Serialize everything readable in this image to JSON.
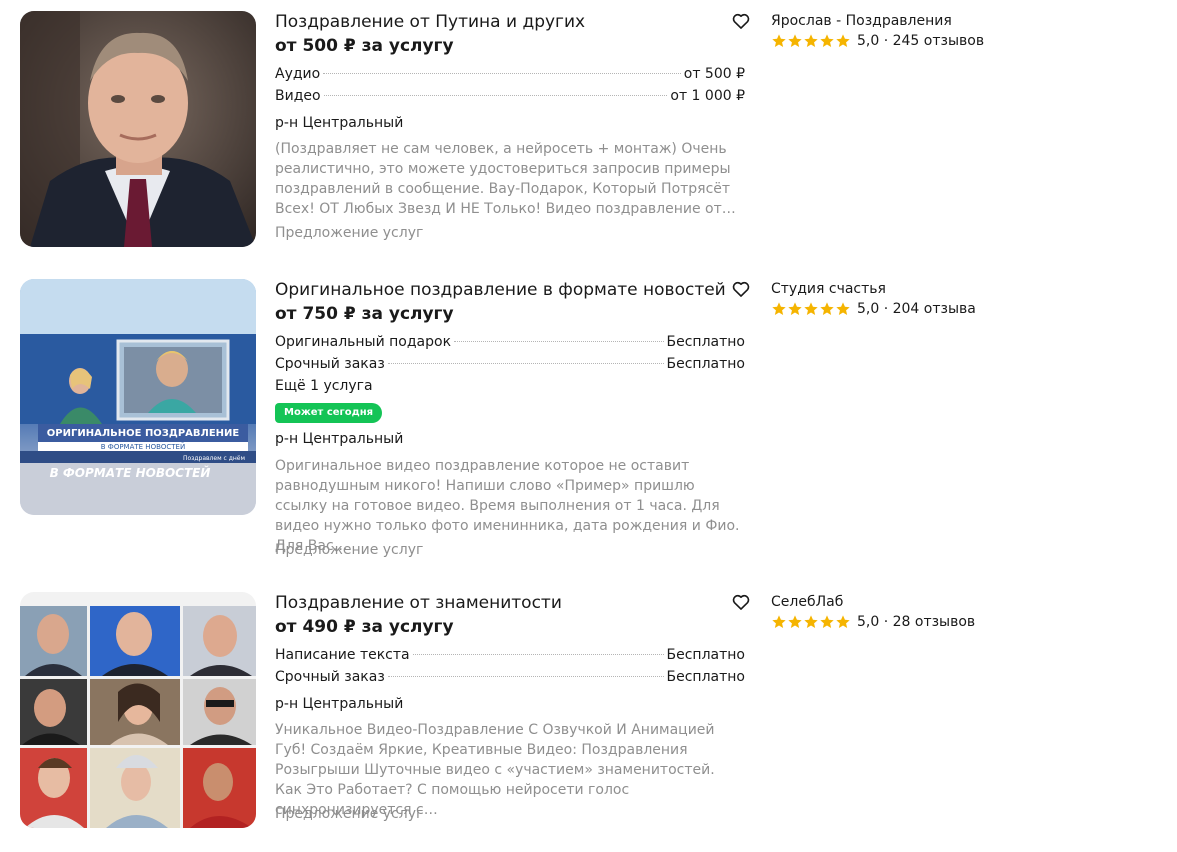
{
  "colors": {
    "star": "#f5b400",
    "badge": "#14c456",
    "muted": "#8f8f8f"
  },
  "listings": [
    {
      "title": "Поздравление от Путина и других",
      "price": "от 500 ₽ за услугу",
      "services": [
        {
          "name": "Аудио",
          "price": "от 500 ₽"
        },
        {
          "name": "Видео",
          "price": "от 1 000 ₽"
        }
      ],
      "district": "р-н Центральный",
      "description": "(Поздравляет не сам человек, а нейросеть + монтаж) Очень реалистично, это можете удостовериться запросив примеры поздравлений в сообщение. Вау-Подарок, Который Потрясёт Всех! ОТ Любых Звезд И НЕ Только! Видео поздравление от…",
      "category": "Предложение услуг",
      "seller": "Ярослав - Поздравления",
      "rating": "5,0 · 245 отзывов",
      "stars": 5,
      "favorite_icon": "heart-icon"
    },
    {
      "title": "Оригинальное поздравление в формате новостей",
      "price": "от 750 ₽ за услугу",
      "services": [
        {
          "name": "Оригинальный подарок",
          "price": "Бесплатно"
        },
        {
          "name": "Срочный заказ",
          "price": "Бесплатно"
        }
      ],
      "more_services": "Ещё 1 услуга",
      "badge": "Может сегодня",
      "district": "р-н Центральный",
      "description": "Оригинальное видео поздравление которое не оставит равнодушным никого! Напиши слово «Пример» пришлю ссылку на готовое видео. Время выполнения от 1 часа. Для видео нужно только фото именинника, дата рождения и Фио. Для Вас…",
      "category": "Предложение услуг",
      "seller": "Студия счастья",
      "rating": "5,0 · 204 отзыва",
      "stars": 5,
      "thumb_text": {
        "line1": "ОРИГИНАЛЬНОЕ ПОЗДРАВЛЕНИЕ",
        "line2": "В ФОРМАТЕ НОВОСТЕЙ",
        "banner": "В ФОРМАТЕ НОВОСТЕЙ",
        "ticker": "Поздравлем с днём"
      }
    },
    {
      "title": "Поздравление от знаменитости",
      "price": "от 490 ₽ за услугу",
      "services": [
        {
          "name": "Написание текста",
          "price": "Бесплатно"
        },
        {
          "name": "Срочный заказ",
          "price": "Бесплатно"
        }
      ],
      "district": "р-н Центральный",
      "description": "Уникальное Видео-Поздравление С Озвучкой И Анимацией Губ! Создаём Яркие, Креативные Видео:   Поздравления   Розыгрыши   Шуточные видео с «участием» знаменитостей. Как Это Работает?  С помощью нейросети голос синхронизируется с…",
      "category": "Предложение услуг",
      "seller": "СелебЛаб",
      "rating": "5,0 · 28 отзывов",
      "stars": 5
    }
  ]
}
